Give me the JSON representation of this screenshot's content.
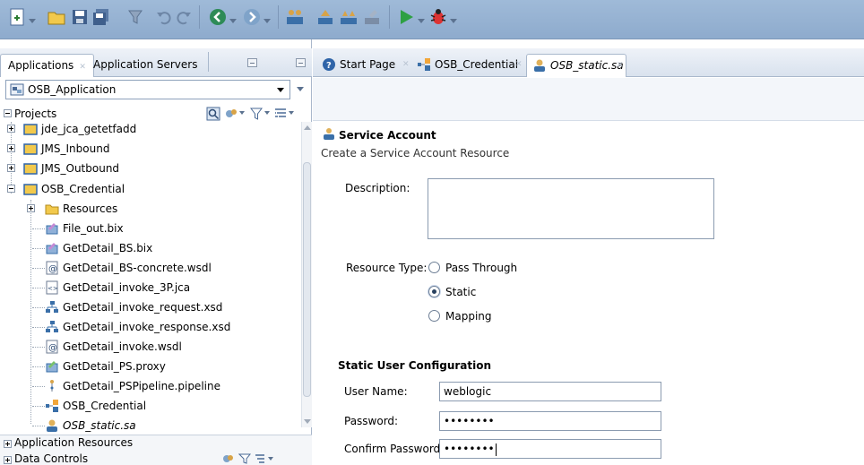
{
  "toolbar": {
    "icons": [
      "new-file-icon",
      "open-folder-icon",
      "save-icon",
      "save-all-icon",
      "filter-icon",
      "undo-icon",
      "redo-icon",
      "back-icon",
      "forward-icon",
      "deploy-icon",
      "build-icon",
      "build-all-icon",
      "clean-icon",
      "run-icon",
      "debug-icon"
    ]
  },
  "left_panel": {
    "tabs": [
      {
        "label": "Applications",
        "active": true
      },
      {
        "label": "Application Servers",
        "active": false
      }
    ],
    "app_selector": {
      "value": "OSB_Application"
    },
    "projects_header": "Projects",
    "tree": [
      {
        "label": "jde_jca_getetfadd",
        "type": "project",
        "expander": "plus"
      },
      {
        "label": "JMS_Inbound",
        "type": "project",
        "expander": "plus"
      },
      {
        "label": "JMS_Outbound",
        "type": "project",
        "expander": "plus"
      },
      {
        "label": "OSB_Credential",
        "type": "project",
        "expander": "minus"
      },
      {
        "label": "Resources",
        "type": "folder",
        "expander": "plus"
      },
      {
        "label": "File_out.bix",
        "type": "business-service"
      },
      {
        "label": "GetDetail_BS.bix",
        "type": "business-service"
      },
      {
        "label": "GetDetail_BS-concrete.wsdl",
        "type": "wsdl"
      },
      {
        "label": "GetDetail_invoke_3P.jca",
        "type": "jca"
      },
      {
        "label": "GetDetail_invoke_request.xsd",
        "type": "xsd"
      },
      {
        "label": "GetDetail_invoke_response.xsd",
        "type": "xsd"
      },
      {
        "label": "GetDetail_invoke.wsdl",
        "type": "wsdl"
      },
      {
        "label": "GetDetail_PS.proxy",
        "type": "proxy"
      },
      {
        "label": "GetDetail_PSPipeline.pipeline",
        "type": "pipeline"
      },
      {
        "label": "OSB_Credential",
        "type": "composite"
      },
      {
        "label": "OSB_static.sa",
        "type": "service-account"
      }
    ],
    "footer": [
      {
        "label": "Application Resources"
      },
      {
        "label": "Data Controls"
      }
    ]
  },
  "editor": {
    "tabs": [
      {
        "label": "Start Page",
        "active": false,
        "icon": "help-icon"
      },
      {
        "label": "OSB_Credential",
        "active": false,
        "icon": "composite-icon"
      },
      {
        "label": "OSB_static.sa",
        "active": true,
        "icon": "service-account-icon"
      }
    ],
    "form": {
      "title": "Service Account",
      "subtitle": "Create a Service Account Resource",
      "description_label": "Description:",
      "resource_type_label": "Resource Type:",
      "resource_types": [
        {
          "label": "Pass Through",
          "selected": false
        },
        {
          "label": "Static",
          "selected": true
        },
        {
          "label": "Mapping",
          "selected": false
        }
      ],
      "section_title": "Static User Configuration",
      "username_label": "User Name:",
      "username_value": "weblogic",
      "password_label": "Password:",
      "password_value": "••••••••",
      "confirm_label": "Confirm Password:",
      "confirm_value": "••••••••"
    }
  }
}
